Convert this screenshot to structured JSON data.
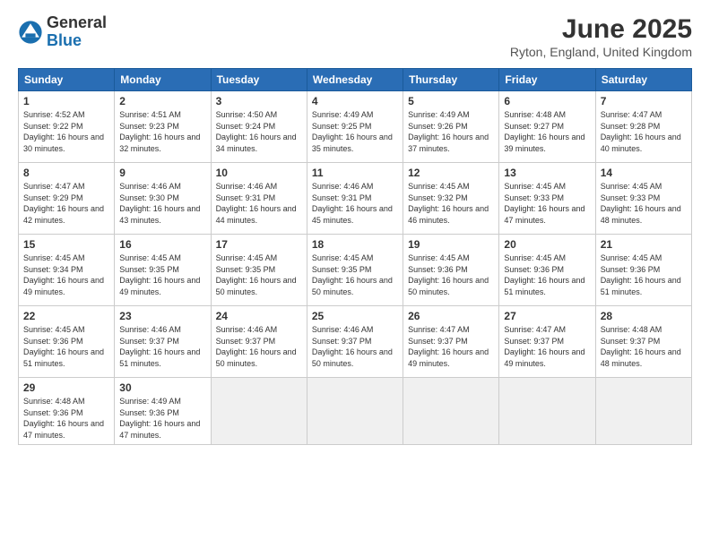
{
  "header": {
    "logo": {
      "general": "General",
      "blue": "Blue"
    },
    "title": "June 2025",
    "location": "Ryton, England, United Kingdom"
  },
  "calendar": {
    "days_of_week": [
      "Sunday",
      "Monday",
      "Tuesday",
      "Wednesday",
      "Thursday",
      "Friday",
      "Saturday"
    ],
    "weeks": [
      [
        {
          "day": null,
          "empty": true
        },
        {
          "day": null,
          "empty": true
        },
        {
          "day": null,
          "empty": true
        },
        {
          "day": null,
          "empty": true
        },
        {
          "day": null,
          "empty": true
        },
        {
          "day": null,
          "empty": true
        },
        {
          "day": null,
          "empty": true
        }
      ]
    ],
    "cells": [
      {
        "num": "1",
        "rise": "Sunrise: 4:52 AM",
        "set": "Sunset: 9:22 PM",
        "daylight": "Daylight: 16 hours and 30 minutes."
      },
      {
        "num": "2",
        "rise": "Sunrise: 4:51 AM",
        "set": "Sunset: 9:23 PM",
        "daylight": "Daylight: 16 hours and 32 minutes."
      },
      {
        "num": "3",
        "rise": "Sunrise: 4:50 AM",
        "set": "Sunset: 9:24 PM",
        "daylight": "Daylight: 16 hours and 34 minutes."
      },
      {
        "num": "4",
        "rise": "Sunrise: 4:49 AM",
        "set": "Sunset: 9:25 PM",
        "daylight": "Daylight: 16 hours and 35 minutes."
      },
      {
        "num": "5",
        "rise": "Sunrise: 4:49 AM",
        "set": "Sunset: 9:26 PM",
        "daylight": "Daylight: 16 hours and 37 minutes."
      },
      {
        "num": "6",
        "rise": "Sunrise: 4:48 AM",
        "set": "Sunset: 9:27 PM",
        "daylight": "Daylight: 16 hours and 39 minutes."
      },
      {
        "num": "7",
        "rise": "Sunrise: 4:47 AM",
        "set": "Sunset: 9:28 PM",
        "daylight": "Daylight: 16 hours and 40 minutes."
      },
      {
        "num": "8",
        "rise": "Sunrise: 4:47 AM",
        "set": "Sunset: 9:29 PM",
        "daylight": "Daylight: 16 hours and 42 minutes."
      },
      {
        "num": "9",
        "rise": "Sunrise: 4:46 AM",
        "set": "Sunset: 9:30 PM",
        "daylight": "Daylight: 16 hours and 43 minutes."
      },
      {
        "num": "10",
        "rise": "Sunrise: 4:46 AM",
        "set": "Sunset: 9:31 PM",
        "daylight": "Daylight: 16 hours and 44 minutes."
      },
      {
        "num": "11",
        "rise": "Sunrise: 4:46 AM",
        "set": "Sunset: 9:31 PM",
        "daylight": "Daylight: 16 hours and 45 minutes."
      },
      {
        "num": "12",
        "rise": "Sunrise: 4:45 AM",
        "set": "Sunset: 9:32 PM",
        "daylight": "Daylight: 16 hours and 46 minutes."
      },
      {
        "num": "13",
        "rise": "Sunrise: 4:45 AM",
        "set": "Sunset: 9:33 PM",
        "daylight": "Daylight: 16 hours and 47 minutes."
      },
      {
        "num": "14",
        "rise": "Sunrise: 4:45 AM",
        "set": "Sunset: 9:33 PM",
        "daylight": "Daylight: 16 hours and 48 minutes."
      },
      {
        "num": "15",
        "rise": "Sunrise: 4:45 AM",
        "set": "Sunset: 9:34 PM",
        "daylight": "Daylight: 16 hours and 49 minutes."
      },
      {
        "num": "16",
        "rise": "Sunrise: 4:45 AM",
        "set": "Sunset: 9:35 PM",
        "daylight": "Daylight: 16 hours and 49 minutes."
      },
      {
        "num": "17",
        "rise": "Sunrise: 4:45 AM",
        "set": "Sunset: 9:35 PM",
        "daylight": "Daylight: 16 hours and 50 minutes."
      },
      {
        "num": "18",
        "rise": "Sunrise: 4:45 AM",
        "set": "Sunset: 9:35 PM",
        "daylight": "Daylight: 16 hours and 50 minutes."
      },
      {
        "num": "19",
        "rise": "Sunrise: 4:45 AM",
        "set": "Sunset: 9:36 PM",
        "daylight": "Daylight: 16 hours and 50 minutes."
      },
      {
        "num": "20",
        "rise": "Sunrise: 4:45 AM",
        "set": "Sunset: 9:36 PM",
        "daylight": "Daylight: 16 hours and 51 minutes."
      },
      {
        "num": "21",
        "rise": "Sunrise: 4:45 AM",
        "set": "Sunset: 9:36 PM",
        "daylight": "Daylight: 16 hours and 51 minutes."
      },
      {
        "num": "22",
        "rise": "Sunrise: 4:45 AM",
        "set": "Sunset: 9:36 PM",
        "daylight": "Daylight: 16 hours and 51 minutes."
      },
      {
        "num": "23",
        "rise": "Sunrise: 4:46 AM",
        "set": "Sunset: 9:37 PM",
        "daylight": "Daylight: 16 hours and 51 minutes."
      },
      {
        "num": "24",
        "rise": "Sunrise: 4:46 AM",
        "set": "Sunset: 9:37 PM",
        "daylight": "Daylight: 16 hours and 50 minutes."
      },
      {
        "num": "25",
        "rise": "Sunrise: 4:46 AM",
        "set": "Sunset: 9:37 PM",
        "daylight": "Daylight: 16 hours and 50 minutes."
      },
      {
        "num": "26",
        "rise": "Sunrise: 4:47 AM",
        "set": "Sunset: 9:37 PM",
        "daylight": "Daylight: 16 hours and 49 minutes."
      },
      {
        "num": "27",
        "rise": "Sunrise: 4:47 AM",
        "set": "Sunset: 9:37 PM",
        "daylight": "Daylight: 16 hours and 49 minutes."
      },
      {
        "num": "28",
        "rise": "Sunrise: 4:48 AM",
        "set": "Sunset: 9:37 PM",
        "daylight": "Daylight: 16 hours and 48 minutes."
      },
      {
        "num": "29",
        "rise": "Sunrise: 4:48 AM",
        "set": "Sunset: 9:36 PM",
        "daylight": "Daylight: 16 hours and 47 minutes."
      },
      {
        "num": "30",
        "rise": "Sunrise: 4:49 AM",
        "set": "Sunset: 9:36 PM",
        "daylight": "Daylight: 16 hours and 47 minutes."
      }
    ]
  }
}
